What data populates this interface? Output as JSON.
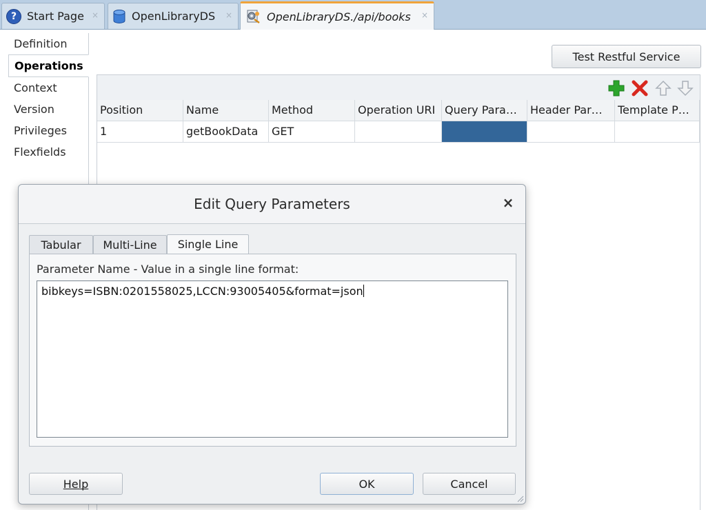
{
  "tabs": [
    {
      "label": "Start Page",
      "icon": "help-icon"
    },
    {
      "label": "OpenLibraryDS",
      "icon": "database-icon"
    },
    {
      "label": "OpenLibraryDS./api/books",
      "icon": "rest-service-icon",
      "active": true
    }
  ],
  "tab_close_glyph": "×",
  "nav": {
    "items": [
      "Definition",
      "Operations",
      "Context",
      "Version",
      "Privileges",
      "Flexfields"
    ],
    "selected": "Operations"
  },
  "main": {
    "test_button_label": "Test Restful Service",
    "toolbar_icons": [
      "add-icon",
      "delete-icon",
      "move-up-icon",
      "move-down-icon"
    ],
    "columns": [
      "Position",
      "Name",
      "Method",
      "Operation URI",
      "Query Para…",
      "Header Par…",
      "Template P…"
    ],
    "rows": [
      {
        "position": "1",
        "name": "getBookData",
        "method": "GET",
        "operation_uri": "",
        "query_params": "",
        "header_params": "",
        "template_params": ""
      }
    ]
  },
  "dialog": {
    "title": "Edit Query Parameters",
    "close_glyph": "×",
    "tabs": [
      "Tabular",
      "Multi-Line",
      "Single Line"
    ],
    "active_tab": "Single Line",
    "label": "Parameter Name - Value in a single line format:",
    "value": "bibkeys=ISBN:0201558025,LCCN:93005405&format=json",
    "help_label": "Help",
    "ok_label": "OK",
    "cancel_label": "Cancel"
  },
  "colors": {
    "selection": "#336699",
    "active_tab_accent": "#f0a33a",
    "add_icon": "#2da52d",
    "delete_icon": "#d8281f"
  }
}
